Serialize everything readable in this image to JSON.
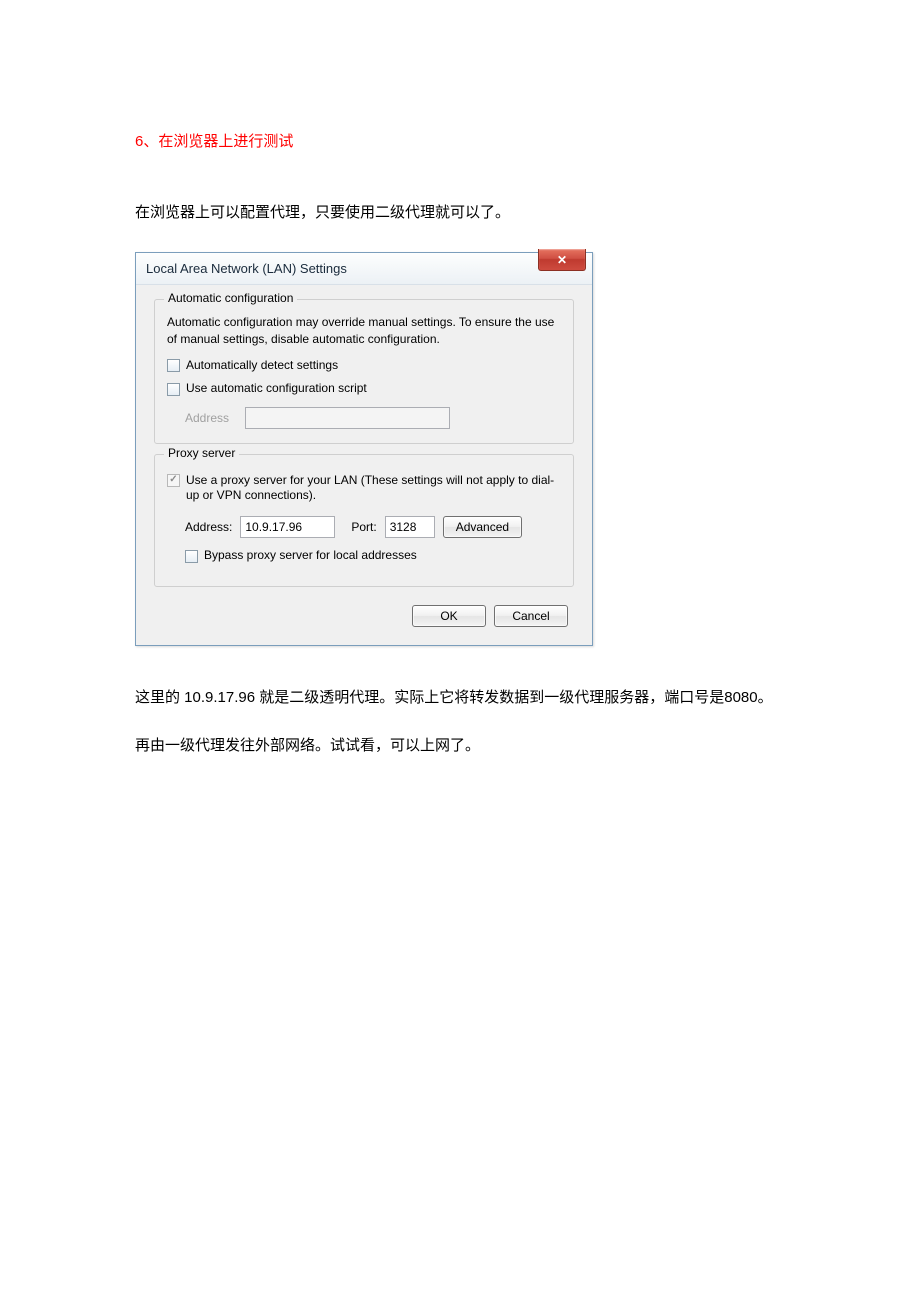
{
  "heading": "6、在浏览器上进行测试",
  "intro": "在浏览器上可以配置代理，只要使用二级代理就可以了。",
  "dialog": {
    "title": "Local Area Network (LAN) Settings",
    "close_glyph": "✕",
    "auto": {
      "legend": "Automatic configuration",
      "desc": "Automatic configuration may override manual settings.  To ensure the use of manual settings, disable automatic configuration.",
      "cb_detect": "Automatically detect settings",
      "cb_script": "Use automatic configuration script",
      "address_label": "Address"
    },
    "proxy": {
      "legend": "Proxy server",
      "cb_use": "Use a proxy server for your LAN (These settings will not apply to dial-up or VPN connections).",
      "address_label": "Address:",
      "address_value": "10.9.17.96",
      "port_label": "Port:",
      "port_value": "3128",
      "advanced": "Advanced",
      "cb_bypass": "Bypass proxy server for local addresses"
    },
    "ok": "OK",
    "cancel": "Cancel"
  },
  "after": "这里的 10.9.17.96 就是二级透明代理。实际上它将转发数据到一级代理服务器，端口号是8080。再由一级代理发往外部网络。试试看，可以上网了。"
}
